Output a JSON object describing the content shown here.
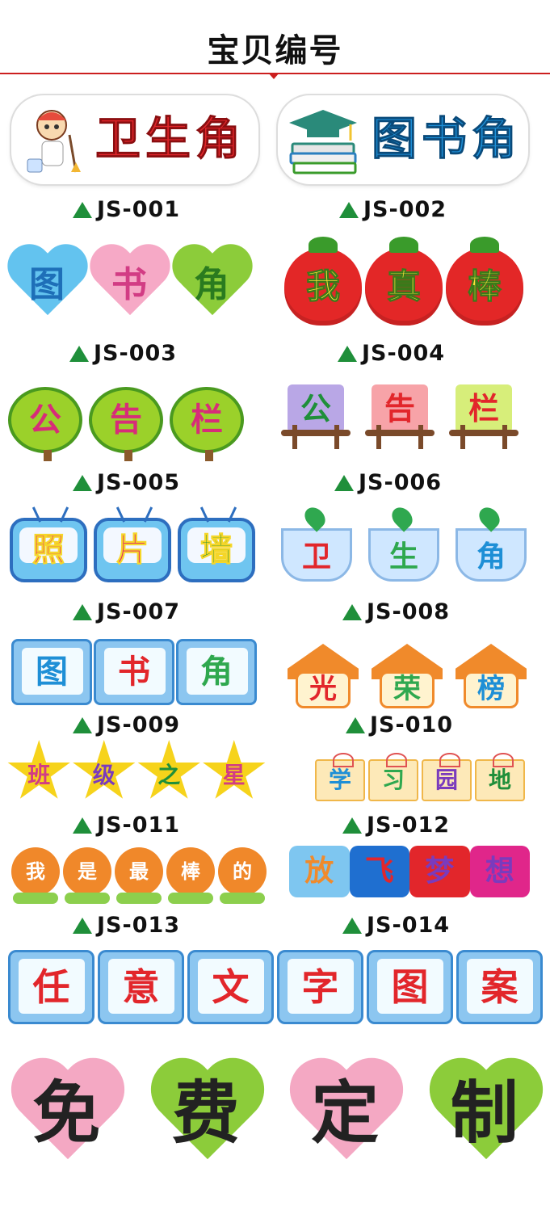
{
  "page": {
    "title": "宝贝编号",
    "accent_color": "#cc1f1f"
  },
  "rows": [
    {
      "code": "JS-001",
      "text": [
        "卫生角"
      ]
    },
    {
      "code": "JS-002",
      "text": [
        "图书角"
      ]
    },
    {
      "code": "JS-003",
      "text": [
        "图",
        "书",
        "角"
      ]
    },
    {
      "code": "JS-004",
      "text": [
        "我",
        "真",
        "棒"
      ]
    },
    {
      "code": "JS-005",
      "text": [
        "公",
        "告",
        "栏"
      ]
    },
    {
      "code": "JS-006",
      "text": [
        "公",
        "告",
        "栏"
      ]
    },
    {
      "code": "JS-007",
      "text": [
        "照",
        "片",
        "墙"
      ]
    },
    {
      "code": "JS-008",
      "text": [
        "卫",
        "生",
        "角"
      ]
    },
    {
      "code": "JS-009",
      "text": [
        "图",
        "书",
        "角"
      ]
    },
    {
      "code": "JS-010",
      "text": [
        "光",
        "荣",
        "榜"
      ]
    },
    {
      "code": "JS-011",
      "text": [
        "班",
        "级",
        "之",
        "星"
      ]
    },
    {
      "code": "JS-012",
      "text": [
        "学",
        "习",
        "园",
        "地"
      ]
    },
    {
      "code": "JS-013",
      "text": [
        "我",
        "是",
        "最",
        "棒",
        "的"
      ]
    },
    {
      "code": "JS-014",
      "text": [
        "放",
        "飞",
        "梦",
        "想"
      ]
    }
  ],
  "custom": {
    "top": [
      "任",
      "意",
      "文",
      "字",
      "图",
      "案"
    ],
    "bottom": [
      "免",
      "费",
      "定",
      "制"
    ]
  },
  "icons": {
    "code_marker": "triangle-icon",
    "js001_decoration": "chef-girl-icon",
    "js002_decoration": "graduation-cap-books-icon"
  }
}
